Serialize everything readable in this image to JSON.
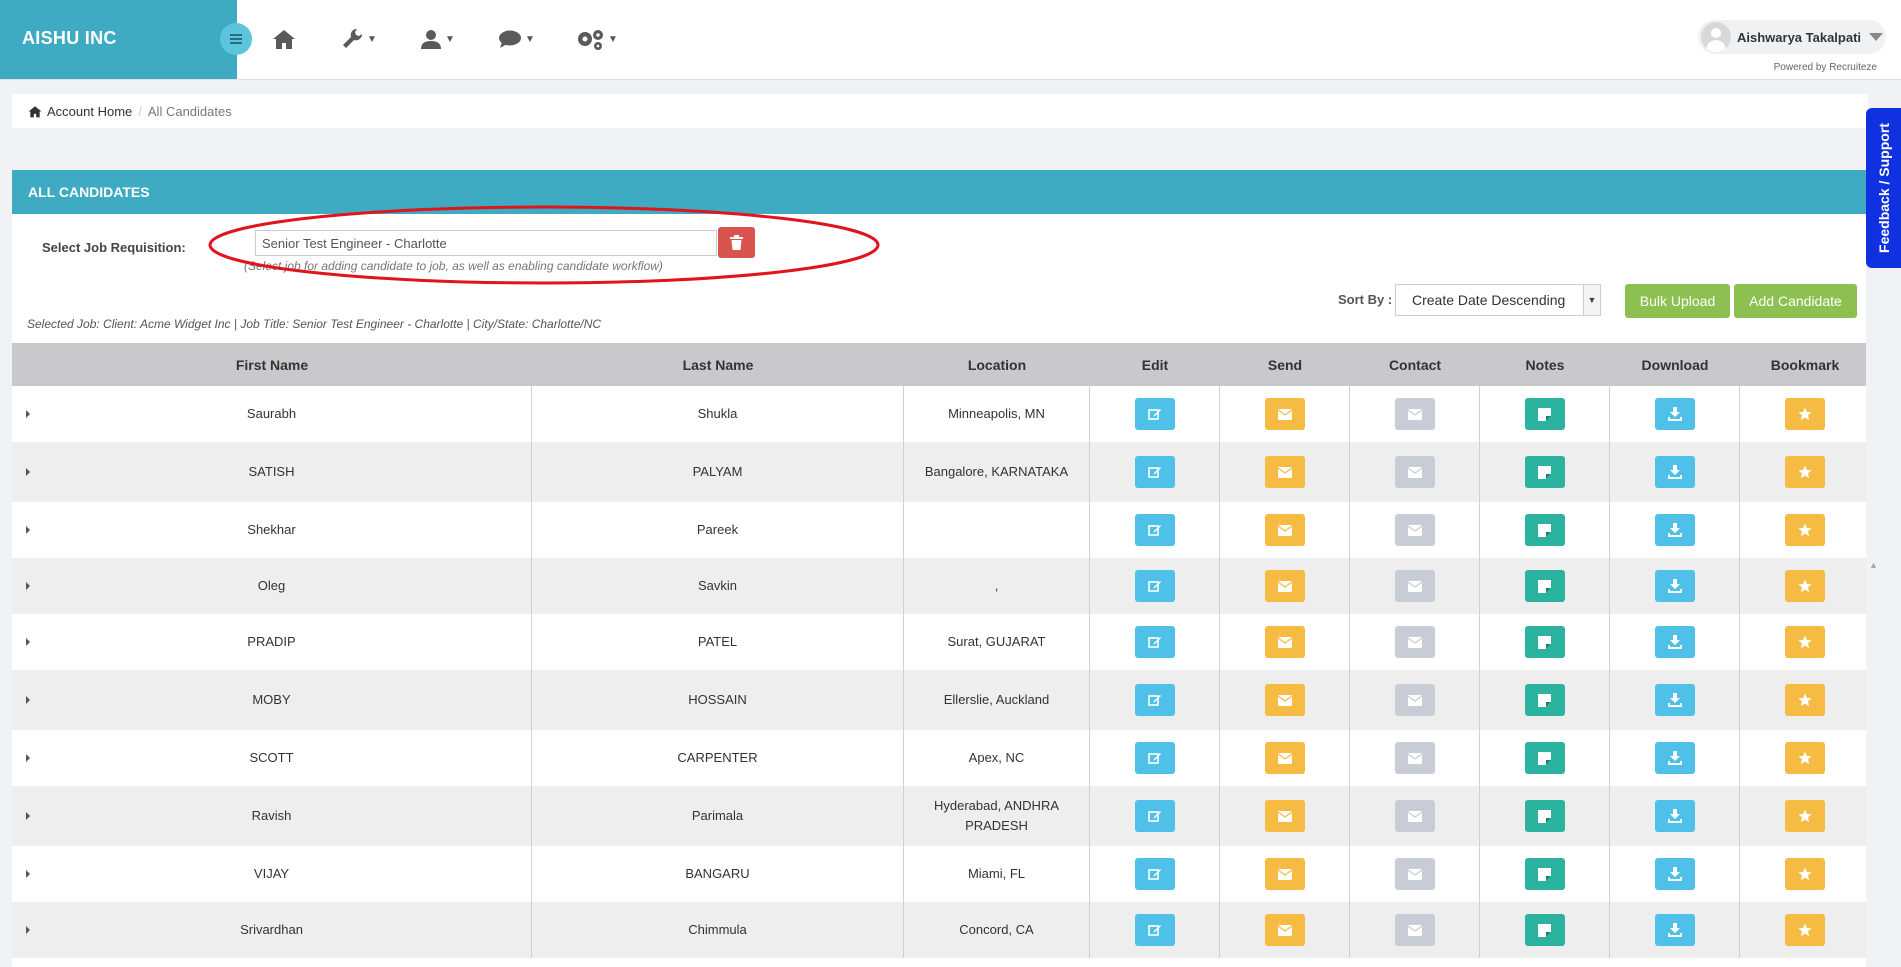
{
  "brand": "AISHU INC",
  "user": {
    "name": "Aishwarya Takalpati",
    "powered_by": "Powered by Recruiteze"
  },
  "nav": {
    "icons": [
      "home-icon",
      "wrench-icon",
      "user-icon",
      "chat-icon",
      "settings-icon"
    ]
  },
  "breadcrumb": {
    "home": "Account Home",
    "separator": "/",
    "current": "All Candidates"
  },
  "feedback": "Feedback / Support",
  "panel": {
    "title": "ALL CANDIDATES",
    "req_label": "Select Job Requisition:",
    "req_value": "Senior Test Engineer - Charlotte",
    "req_hint": "(Select job for adding candidate to job, as well as enabling candidate workflow)",
    "sort_label": "Sort By :",
    "sort_value": "Create Date Descending",
    "bulk_upload": "Bulk Upload",
    "add_candidate": "Add Candidate",
    "selected_job": "Selected Job: Client: Acme Widget Inc | Job Title: Senior Test Engineer - Charlotte | City/State: Charlotte/NC"
  },
  "table": {
    "headers": [
      "First Name",
      "Last Name",
      "Location",
      "Edit",
      "Send",
      "Contact",
      "Notes",
      "Download",
      "Bookmark"
    ],
    "rows": [
      {
        "first": "Saurabh",
        "last": "Shukla",
        "location": "Minneapolis, MN"
      },
      {
        "first": "SATISH",
        "last": "PALYAM",
        "location": "Bangalore, KARNATAKA"
      },
      {
        "first": "Shekhar",
        "last": "Pareek",
        "location": ""
      },
      {
        "first": "Oleg",
        "last": "Savkin",
        "location": ","
      },
      {
        "first": "PRADIP",
        "last": "PATEL",
        "location": "Surat, GUJARAT"
      },
      {
        "first": "MOBY",
        "last": "HOSSAIN",
        "location": "Ellerslie, Auckland"
      },
      {
        "first": "SCOTT",
        "last": "CARPENTER",
        "location": "Apex, NC"
      },
      {
        "first": "Ravish",
        "last": "Parimala",
        "location": "Hyderabad, ANDHRA PRADESH"
      },
      {
        "first": "VIJAY",
        "last": "BANGARU",
        "location": "Miami, FL"
      },
      {
        "first": "Srivardhan",
        "last": "Chimmula",
        "location": "Concord, CA"
      }
    ]
  },
  "colors": {
    "brand": "#3eabc2",
    "edit": "#4fc1e9",
    "send": "#f6bb42",
    "contact": "#c8ccd4",
    "notes": "#2bb3a0",
    "download": "#4fc1e9",
    "bookmark": "#f6bb42",
    "delete": "#d9534f",
    "green_button": "#8cc152",
    "feedback": "#1031e0"
  }
}
